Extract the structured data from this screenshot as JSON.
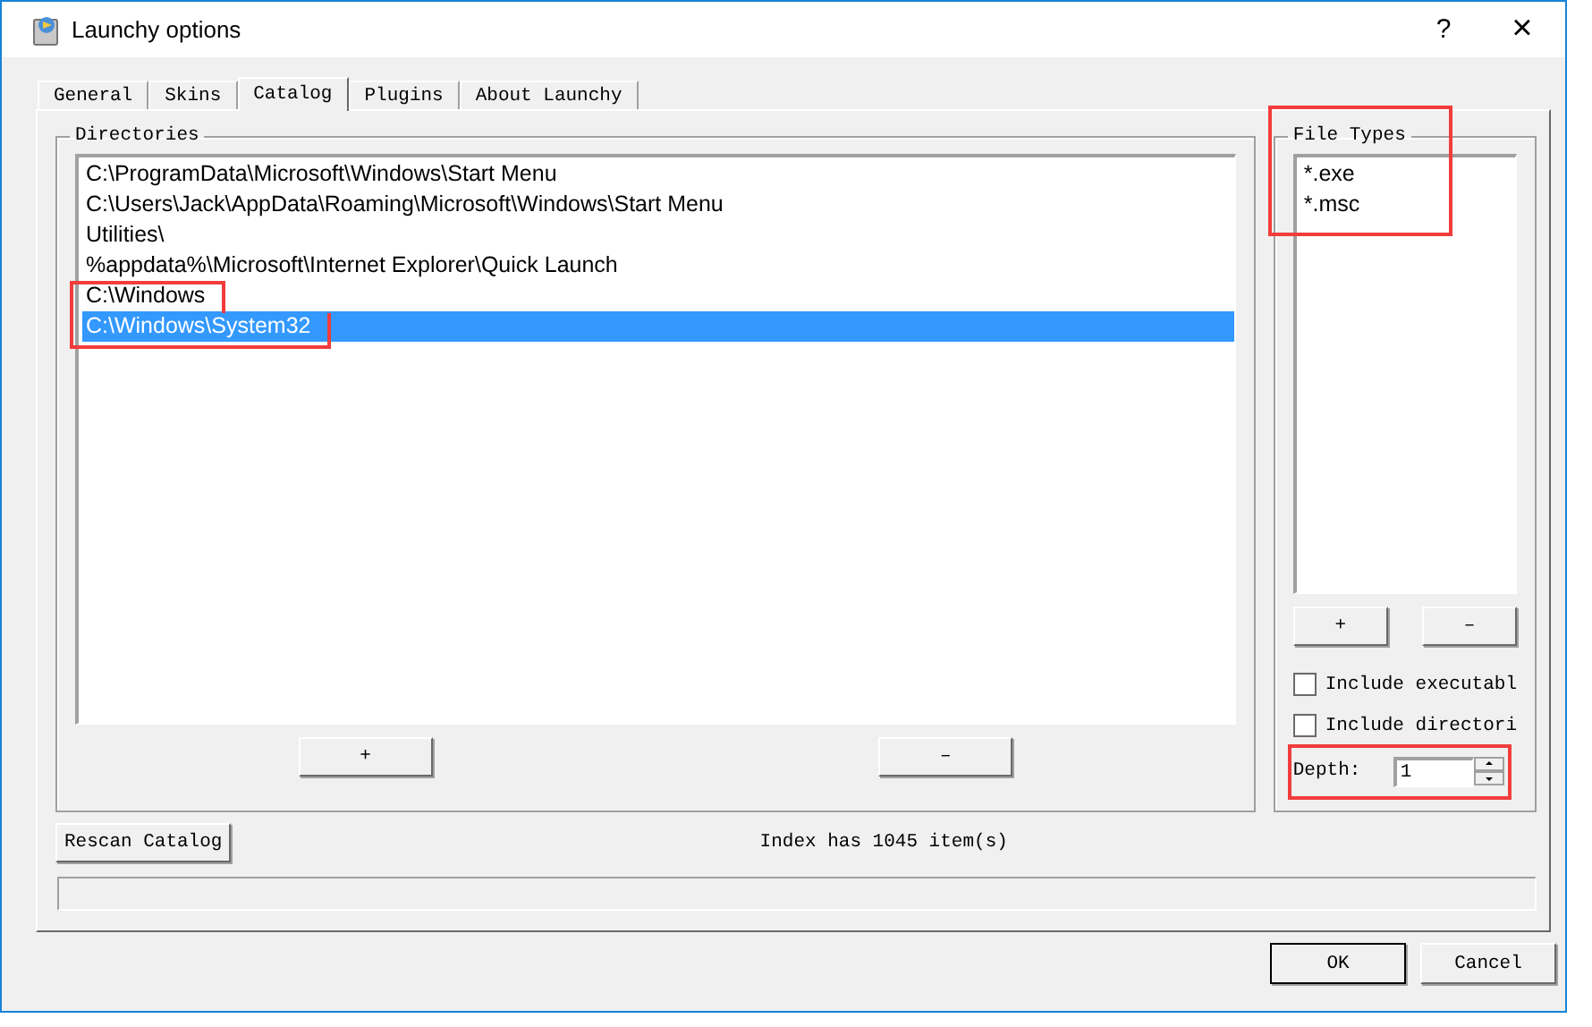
{
  "window": {
    "title": "Launchy options",
    "help_button": "?",
    "close_button": "×"
  },
  "tabs": [
    {
      "label": "General",
      "selected": false
    },
    {
      "label": "Skins",
      "selected": false
    },
    {
      "label": "Catalog",
      "selected": true
    },
    {
      "label": "Plugins",
      "selected": false
    },
    {
      "label": "About Launchy",
      "selected": false
    }
  ],
  "directories": {
    "label": "Directories",
    "items": [
      {
        "text": "C:\\ProgramData\\Microsoft\\Windows\\Start Menu",
        "selected": false,
        "highlighted": false
      },
      {
        "text": "C:\\Users\\Jack\\AppData\\Roaming\\Microsoft\\Windows\\Start Menu",
        "selected": false,
        "highlighted": false
      },
      {
        "text": "Utilities\\",
        "selected": false,
        "highlighted": false
      },
      {
        "text": "%appdata%\\Microsoft\\Internet Explorer\\Quick Launch",
        "selected": false,
        "highlighted": false
      },
      {
        "text": "C:\\Windows",
        "selected": false,
        "highlighted": true
      },
      {
        "text": "C:\\Windows\\System32",
        "selected": true,
        "highlighted": true
      }
    ],
    "add_button": "+",
    "remove_button": "–"
  },
  "file_types": {
    "label": "File Types",
    "highlighted": true,
    "items": [
      {
        "text": "*.exe",
        "selected": false
      },
      {
        "text": "*.msc",
        "selected": false
      }
    ],
    "add_button": "+",
    "remove_button": "–",
    "options": [
      {
        "label": "Include executabl",
        "checked": false
      },
      {
        "label": "Include directori",
        "checked": false
      }
    ],
    "depth": {
      "label": "Depth:",
      "value": "1",
      "highlighted": true
    }
  },
  "rescan_button": "Rescan Catalog",
  "index_status": "Index has 1045 item(s)",
  "progress": {
    "level": 0
  },
  "buttons": [
    {
      "label": "OK",
      "kind": "default"
    },
    {
      "label": "Cancel",
      "kind": "normal"
    }
  ]
}
